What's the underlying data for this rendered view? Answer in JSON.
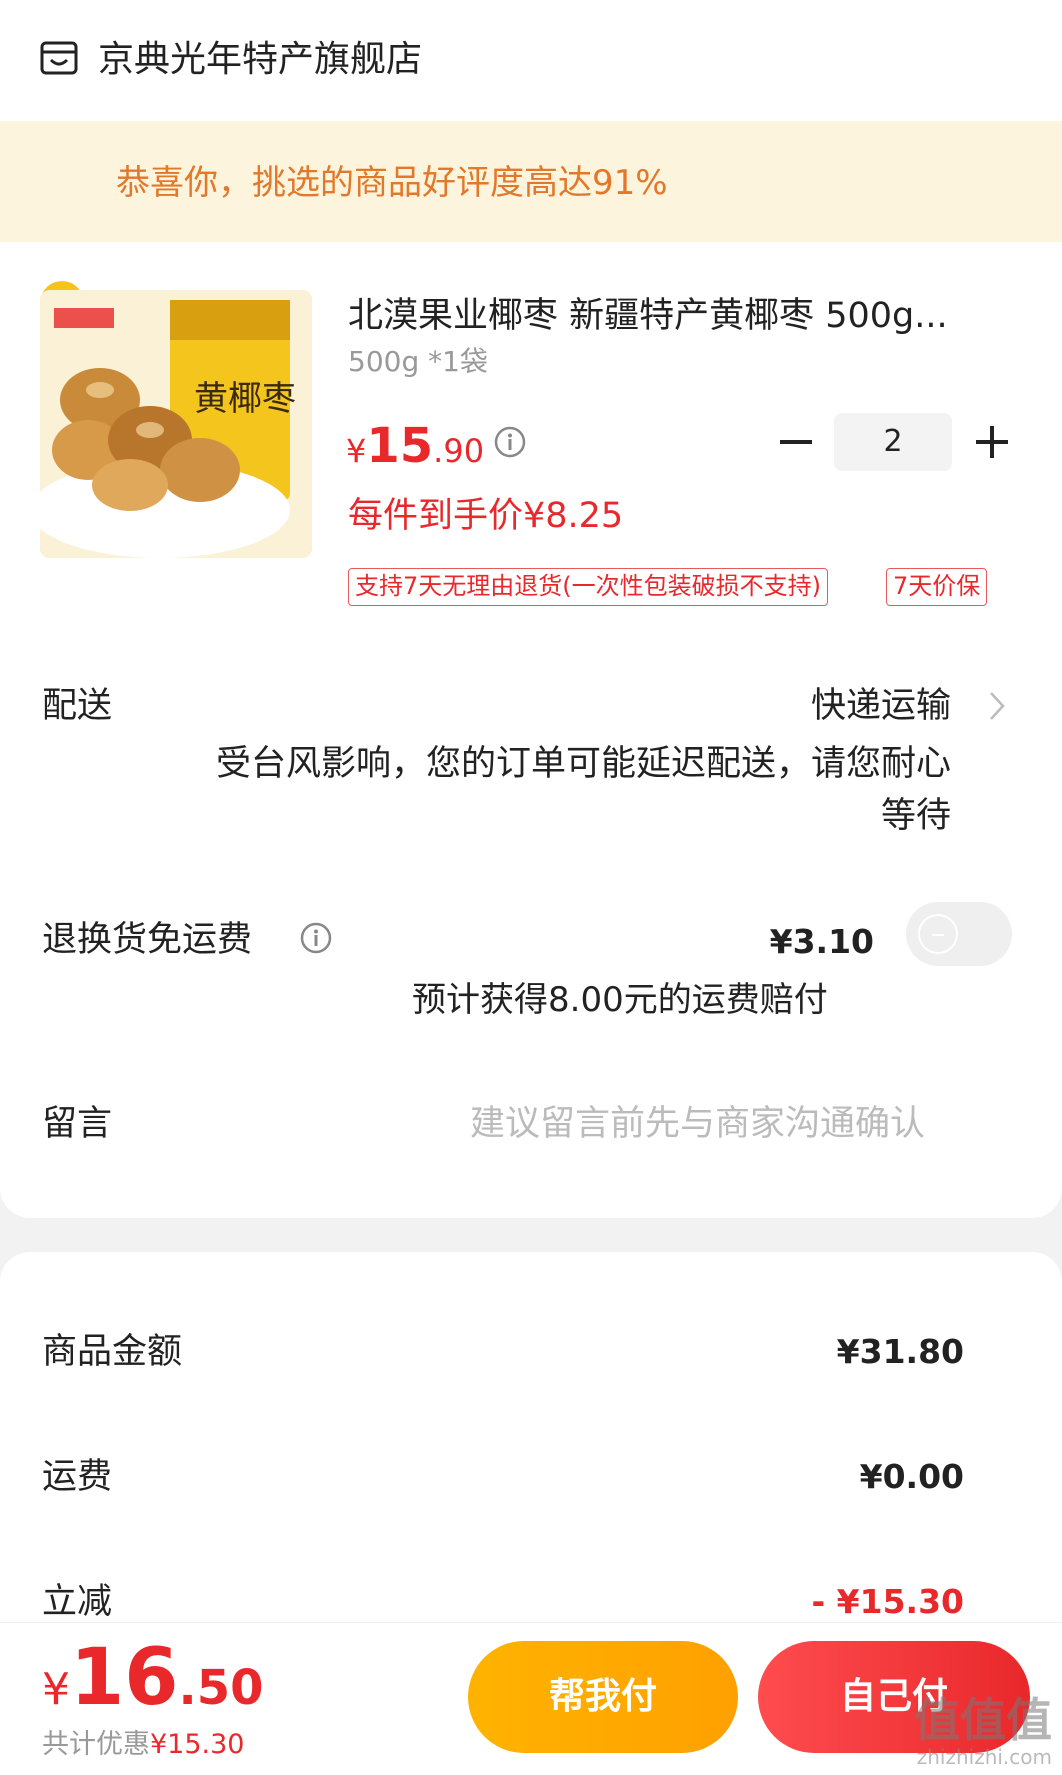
{
  "shop": {
    "name": "京典光年特产旗舰店",
    "icon": "store-icon"
  },
  "banner": {
    "text": "恭喜你，挑选的商品好评度高达91%",
    "icon": "thumbs-up-icon"
  },
  "product": {
    "title": "北漠果业椰枣 新疆特产黄椰枣 500g...",
    "spec": "500g *1袋",
    "price_currency": "¥",
    "price_int": "15",
    "price_dec": ".90",
    "quantity": "2",
    "unit_price": "每件到手价¥8.25",
    "tags": [
      "支持7天无理由退货(一次性包装破损不支持)",
      "7天价保"
    ],
    "image_text": "黄椰枣"
  },
  "delivery": {
    "label": "配送",
    "method": "快递运输",
    "note": "受台风影响，您的订单可能延迟配送，请您耐心等待"
  },
  "return_insurance": {
    "label": "退换货免运费",
    "fee": "¥3.10",
    "note": "预计获得8.00元的运费赔付",
    "enabled": false
  },
  "message": {
    "label": "留言",
    "placeholder": "建议留言前先与商家沟通确认"
  },
  "summary": {
    "goods_label": "商品金额",
    "goods_value": "¥31.80",
    "shipping_label": "运费",
    "shipping_value": "¥0.00",
    "discount_label": "立减",
    "discount_value": "- ¥15.30"
  },
  "bottom": {
    "total_currency": "¥",
    "total_int": "16",
    "total_dec": ".50",
    "saved_label": "共计优惠",
    "saved_value": "¥15.30",
    "help_pay": "帮我付",
    "self_pay": "自己付"
  },
  "watermark": {
    "logo": "值值值",
    "site": "zhizhizhi.com"
  },
  "colors": {
    "accent": "#e8282b",
    "banner_bg": "#fcf4dc",
    "banner_text": "#e2782a",
    "help_button": "#ffa000"
  }
}
